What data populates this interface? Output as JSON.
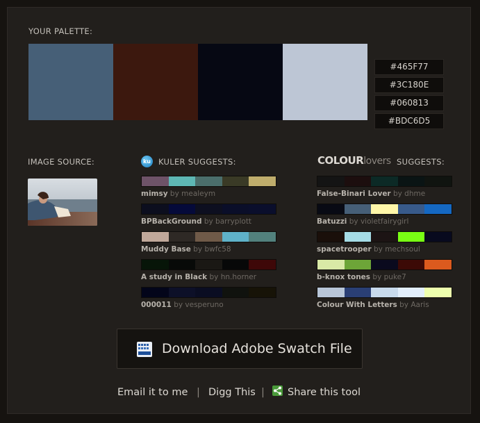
{
  "palette": {
    "title": "YOUR PALETTE:",
    "colors": [
      "#465F77",
      "#3C180E",
      "#060813",
      "#BDC6D5"
    ],
    "hex_labels": [
      "#465F77",
      "#3C180E",
      "#060813",
      "#BDC6D5"
    ]
  },
  "image_source": {
    "title": "IMAGE SOURCE:"
  },
  "kuler": {
    "title": "KULER SUGGESTS:",
    "logo_text": "ku",
    "items": [
      {
        "name": "mimsy",
        "by": "by mealeym",
        "colors": [
          "#6E5368",
          "#5EB7B4",
          "#4B6E6B",
          "#3A3A26",
          "#BFAD6C"
        ]
      },
      {
        "name": "BPBackGround",
        "by": "by barryplott",
        "colors": [
          "#0C0E1E",
          "#050A3A",
          "#0D0F20",
          "#0A0E29",
          "#0A0E2C"
        ]
      },
      {
        "name": "Muddy Base",
        "by": "by bwfc58",
        "colors": [
          "#C0A89A",
          "#2E2925",
          "#6F5A48",
          "#5FB2C8",
          "#52817D"
        ]
      },
      {
        "name": "A study in Black",
        "by": "by hn.horner",
        "colors": [
          "#071508",
          "#080A08",
          "#1A1814",
          "#070808",
          "#3E0808"
        ]
      },
      {
        "name": "000011",
        "by": "by vesperuno",
        "colors": [
          "#03051A",
          "#0D1028",
          "#0A0D22",
          "#10120E",
          "#171307"
        ]
      }
    ]
  },
  "colourlovers": {
    "title": "SUGGESTS:",
    "logo_bold": "COLOUR",
    "logo_light": "lovers",
    "items": [
      {
        "name": "False-Binari Lover",
        "by": "by dhme",
        "colors": [
          "#141414",
          "#1C0E0E",
          "#0C2A26",
          "#0A1414",
          "#101410"
        ]
      },
      {
        "name": "Batuzzi",
        "by": "by violetfairygirl",
        "colors": [
          "#080A14",
          "#465F77",
          "#FFF7A8",
          "#385A8A",
          "#1568C2"
        ]
      },
      {
        "name": "spacetrooper",
        "by": "by mechsoul",
        "colors": [
          "#1A0F0A",
          "#A5DCE6",
          "#1C1414",
          "#79FF14",
          "#080A1E"
        ]
      },
      {
        "name": "b-knox tones",
        "by": "by puke7",
        "colors": [
          "#D9E9A6",
          "#6DA538",
          "#0A0A1E",
          "#3C0A06",
          "#DC5A1E"
        ]
      },
      {
        "name": "Colour With Letters",
        "by": "by Aaris",
        "colors": [
          "#B8C6D8",
          "#2A3F75",
          "#C8DAEC",
          "#E2EEFB",
          "#EEFFAE"
        ]
      }
    ]
  },
  "download": {
    "label": "Download Adobe Swatch File",
    "icon": "swatch-file-icon"
  },
  "footer": {
    "email": "Email it to me",
    "digg": "Digg This",
    "share": "Share this tool",
    "separator": "|"
  }
}
